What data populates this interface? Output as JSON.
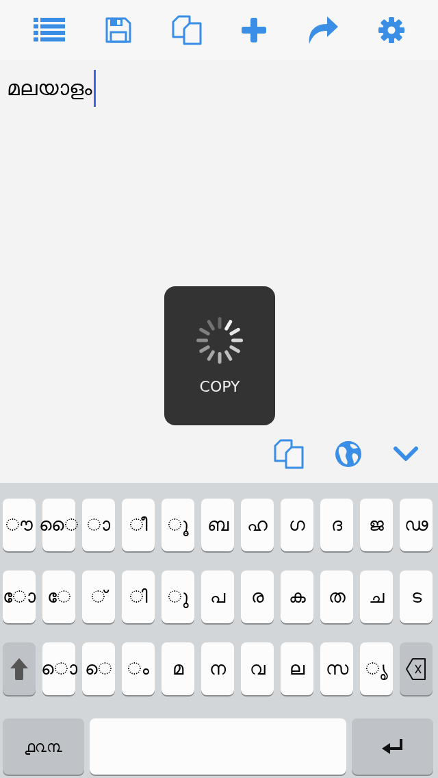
{
  "editor": {
    "text": "മലയാളം"
  },
  "hud": {
    "label": "COPY"
  },
  "keyboard": {
    "rows": [
      [
        {
          "kind": "char",
          "label": "◌ൗ"
        },
        {
          "kind": "char",
          "label": "◌ൈ"
        },
        {
          "kind": "char",
          "label": "◌ാ"
        },
        {
          "kind": "char",
          "label": "◌ീ"
        },
        {
          "kind": "char",
          "label": "◌ൂ"
        },
        {
          "kind": "char",
          "label": "ബ"
        },
        {
          "kind": "char",
          "label": "ഹ"
        },
        {
          "kind": "char",
          "label": "ഗ"
        },
        {
          "kind": "char",
          "label": "ദ"
        },
        {
          "kind": "char",
          "label": "ജ"
        },
        {
          "kind": "char",
          "label": "ഢ"
        }
      ],
      [
        {
          "kind": "char",
          "label": "◌ോ"
        },
        {
          "kind": "char",
          "label": "◌േ"
        },
        {
          "kind": "char",
          "label": "◌്"
        },
        {
          "kind": "char",
          "label": "◌ി"
        },
        {
          "kind": "char",
          "label": "◌ു"
        },
        {
          "kind": "char",
          "label": "പ"
        },
        {
          "kind": "char",
          "label": "ര"
        },
        {
          "kind": "char",
          "label": "ക"
        },
        {
          "kind": "char",
          "label": "ത"
        },
        {
          "kind": "char",
          "label": "ച"
        },
        {
          "kind": "char",
          "label": "ട"
        }
      ],
      [
        {
          "kind": "shift"
        },
        {
          "kind": "char",
          "label": "◌ൊ"
        },
        {
          "kind": "char",
          "label": "◌െ"
        },
        {
          "kind": "char",
          "label": "ം"
        },
        {
          "kind": "char",
          "label": "മ"
        },
        {
          "kind": "char",
          "label": "ന"
        },
        {
          "kind": "char",
          "label": "വ"
        },
        {
          "kind": "char",
          "label": "ല"
        },
        {
          "kind": "char",
          "label": "സ"
        },
        {
          "kind": "char",
          "label": "◌ൃ"
        },
        {
          "kind": "backspace"
        }
      ],
      [
        {
          "kind": "digits",
          "label": "൧൨൩"
        },
        {
          "kind": "space"
        },
        {
          "kind": "return"
        }
      ]
    ]
  }
}
